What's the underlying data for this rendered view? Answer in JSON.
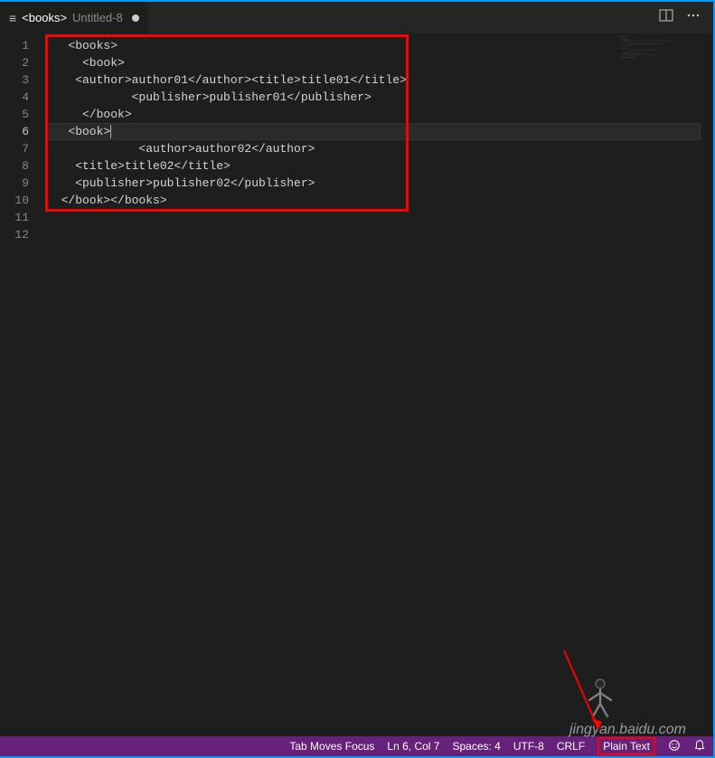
{
  "tab": {
    "icon_glyph": "≡",
    "title": "<books>",
    "subtitle": "Untitled-8",
    "dirty": true
  },
  "editor_actions": {
    "split": "split-editor-icon",
    "more": "more-icon"
  },
  "lines": [
    "   <books>",
    "     <book>",
    "    <author>author01</author><title>title01</title>",
    "            <publisher>publisher01</publisher>",
    "     </book>",
    "   <book>",
    "             <author>author02</author>",
    "    <title>title02</title>",
    "    <publisher>publisher02</publisher>",
    "  </book></books>",
    "",
    ""
  ],
  "active_line_index": 5,
  "status": {
    "tab_focus": "Tab Moves Focus",
    "cursor": "Ln 6, Col 7",
    "spaces": "Spaces: 4",
    "encoding": "UTF-8",
    "eol": "CRLF",
    "language": "Plain Text"
  },
  "watermark": "jingyan.baidu.com"
}
